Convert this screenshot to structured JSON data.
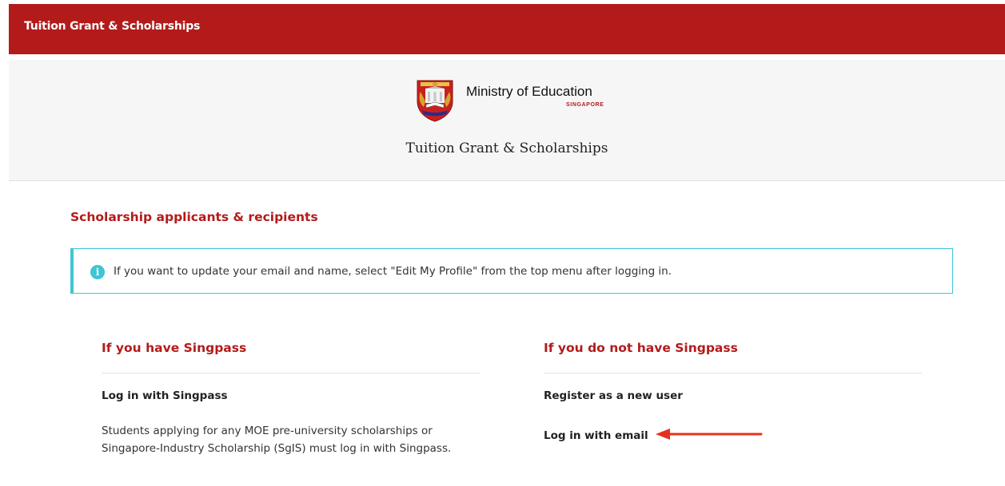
{
  "colors": {
    "brand": "#b31b1b",
    "info": "#3fc5d3",
    "arrow": "#e8311c"
  },
  "topbar": {
    "title": "Tuition Grant & Scholarships"
  },
  "header": {
    "ministry_name": "Ministry of Education",
    "ministry_sub": "SINGAPORE",
    "site_title": "Tuition Grant & Scholarships"
  },
  "main": {
    "section_title": "Scholarship applicants & recipients",
    "info_text": "If you want to update your email and name, select \"Edit My Profile\" from the top menu after logging in.",
    "left": {
      "heading": "If you have Singpass",
      "link": "Log in with Singpass",
      "note": "Students applying for any MOE pre-university scholarships or Singapore-Industry Scholarship (SgIS) must log in with Singpass."
    },
    "right": {
      "heading": "If you do not have Singpass",
      "link_register": "Register as a new user",
      "link_email": "Log in with email"
    }
  },
  "icons": {
    "crest": "moe-crest-icon",
    "info": "info-icon",
    "arrow": "left-arrow-icon"
  }
}
